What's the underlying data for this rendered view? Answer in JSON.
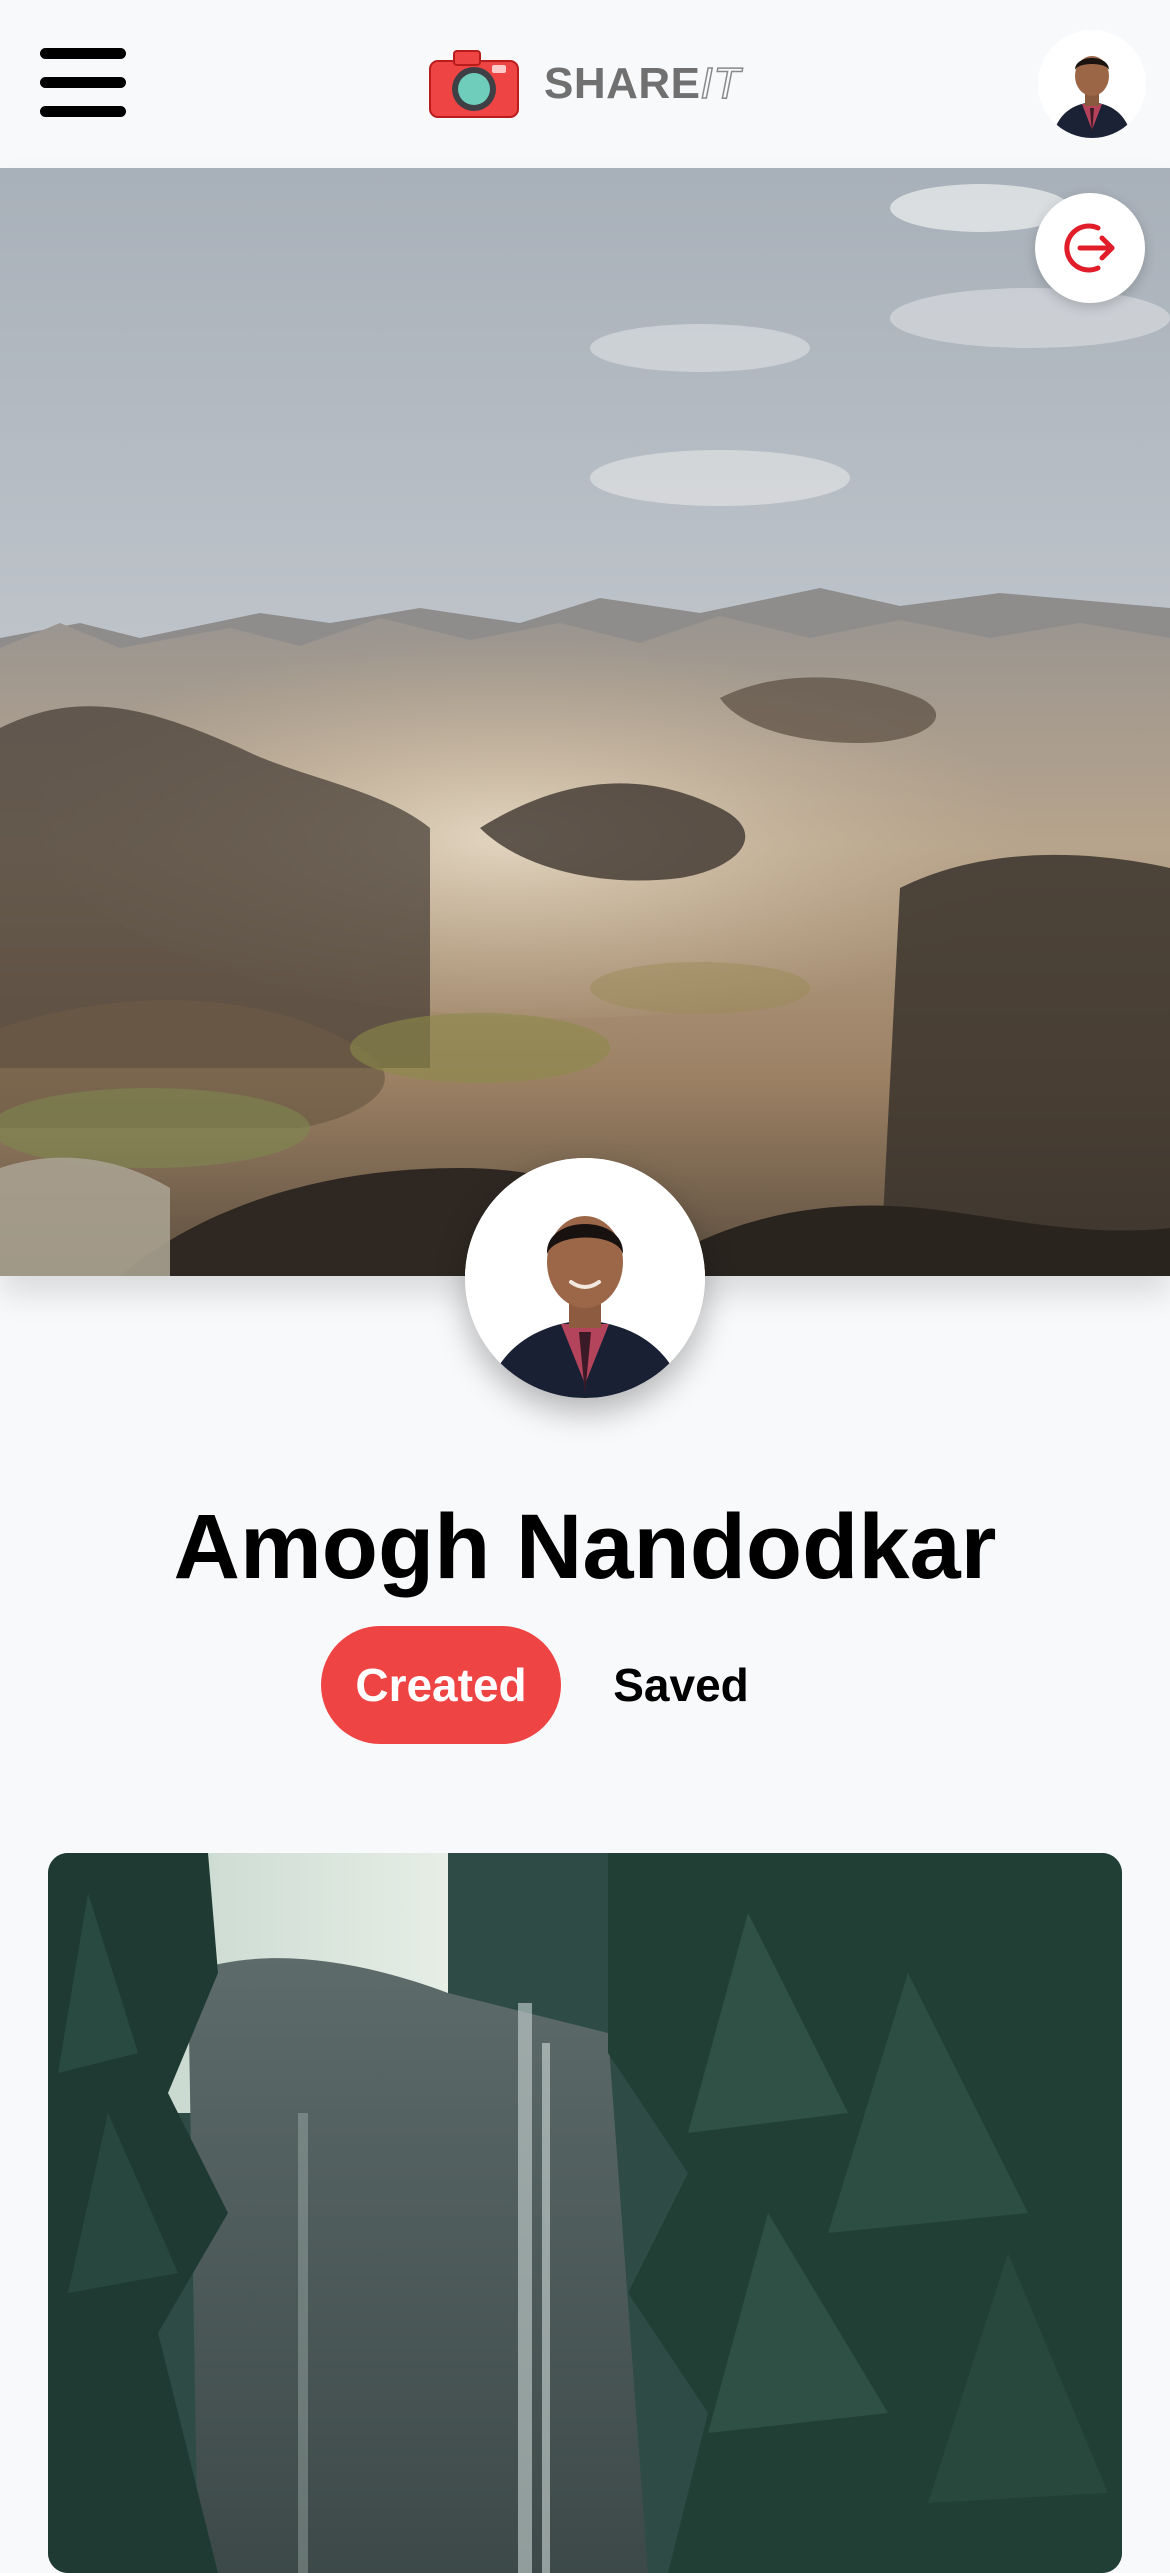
{
  "app": {
    "brand_main": "SHARE",
    "brand_suffix": "IT",
    "accent_color": "#ef4444",
    "background_color": "#f8f9fb"
  },
  "navbar": {
    "menu_icon": "hamburger-menu-icon",
    "logo_icon": "camera-icon",
    "avatar_icon": "user-avatar"
  },
  "cover": {
    "image": "desert-hills-landscape",
    "logout_icon": "logout-icon"
  },
  "profile": {
    "name": "Amogh Nandodkar",
    "avatar": "profile-photo"
  },
  "tabs": [
    {
      "label": "Created",
      "active": true
    },
    {
      "label": "Saved",
      "active": false
    }
  ],
  "pins": [
    {
      "image": "waterfall-forest"
    }
  ]
}
